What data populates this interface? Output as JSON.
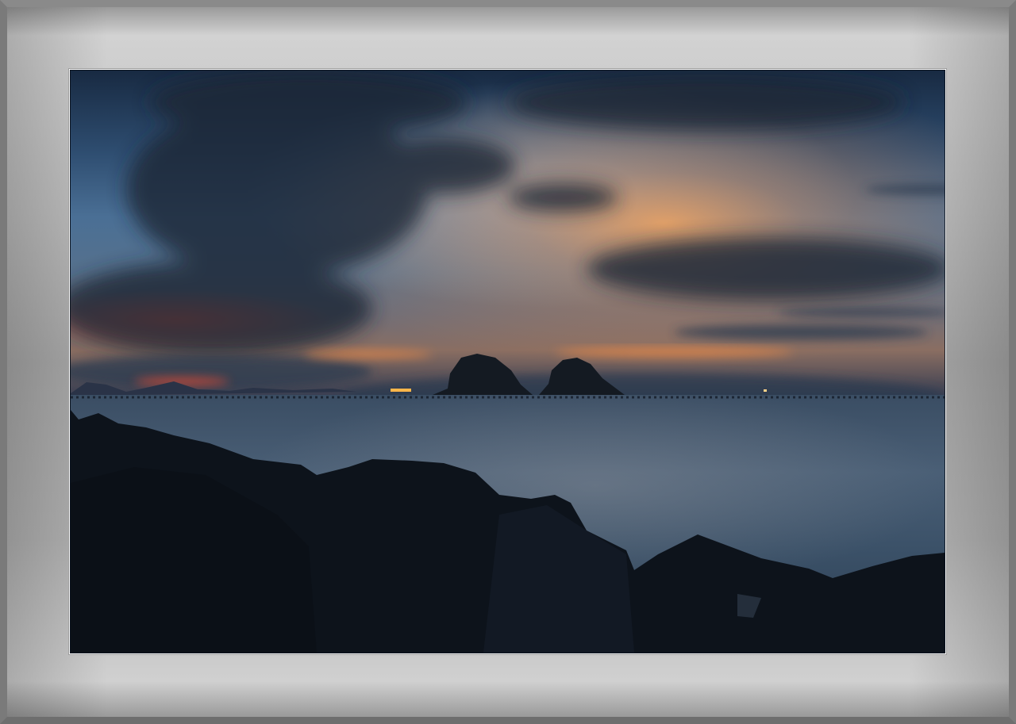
{
  "image": {
    "subject": "seascape-at-dusk",
    "elements": [
      "sky",
      "clouds",
      "sunset-glow",
      "sea",
      "twin-rocky-islets",
      "distant-mountains",
      "distant-ship-light",
      "foreground-rocks"
    ]
  },
  "colors": {
    "frame": "#b8b8b8",
    "frame_edge": "#7a7a7a",
    "mat_line": "#ffffff",
    "sky_top": "#1f3550",
    "sky_mid": "#4f7296",
    "sky_light": "#8fb2cf",
    "glow": "#e5873f",
    "sea": "#33475e",
    "rock": "#0e141c"
  }
}
